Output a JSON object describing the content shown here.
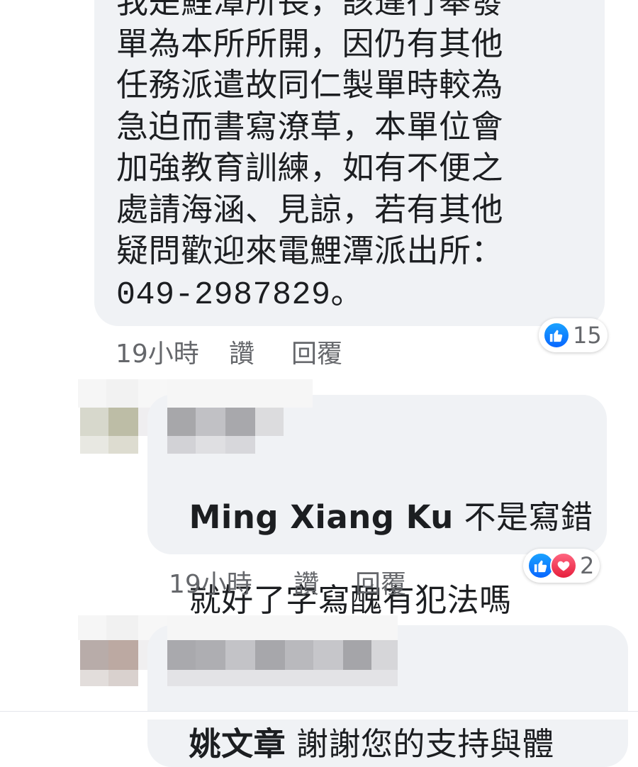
{
  "comment1": {
    "text": "我是鯉潭所長，該違行舉發\n單為本所所開，因仍有其他\n任務派遣故同仁製單時較為\n急迫而書寫潦草，本單位會\n加強教育訓練，如有不便之\n處請海涵、見諒，若有其他\n疑問歡迎來電鯉潭派出所：\n049-2987829。",
    "time": "19小時",
    "like_label": "讚",
    "reply_label": "回覆",
    "reaction_count": "15"
  },
  "comment2": {
    "author": "Ming Xiang Ku",
    "text_line1": " 不是寫錯",
    "text_line2": "就好了字寫醜有犯法嗎",
    "time": "19小時",
    "like_label": "讚",
    "reply_label": "回覆",
    "reaction_count": "2"
  },
  "comment3": {
    "author": "姚文章",
    "text": " 謝謝您的支持與體"
  },
  "colors": {
    "bubble": "#f0f2f5",
    "meta_text": "#65676b",
    "like_blue": "#0866ff",
    "love_red": "#e61e3c"
  }
}
